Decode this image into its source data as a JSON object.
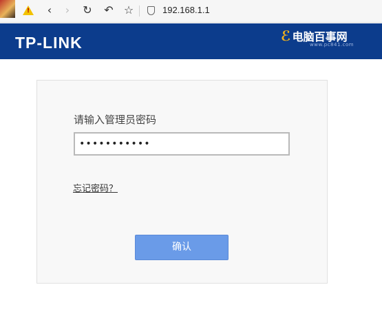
{
  "browser": {
    "url": "192.168.1.1",
    "icons": [
      "back-icon",
      "forward-icon",
      "reload-icon",
      "undo-icon",
      "star-icon",
      "shield-icon"
    ],
    "glyphs": {
      "back": "‹",
      "forward": "›",
      "reload": "↻",
      "undo": "↶",
      "star": "☆"
    }
  },
  "header": {
    "logo": "TP-LINK",
    "watermark": "电脑百事网",
    "watermark_sub": "www.pc841.com",
    "background_color": "#0c3c8c"
  },
  "login": {
    "prompt": "请输入管理员密码",
    "password_value": "•••••••••••",
    "forgot_link": "忘记密码？",
    "confirm_label": "确认",
    "button_color": "#6a9be8"
  }
}
